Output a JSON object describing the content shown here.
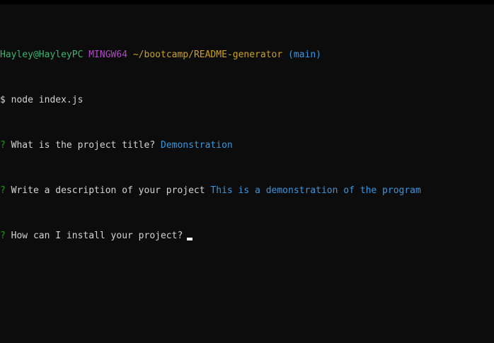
{
  "colors": {
    "user_host": "#3cb371",
    "system": "#b148c6",
    "path": "#c9a227",
    "branch": "#3a96dd",
    "text": "#d4d4d4",
    "answer": "#3a96dd",
    "question_mark": "#13a10e"
  },
  "prompt_line": {
    "user_host": "Hayley@HayleyPC",
    "system": "MINGW64",
    "path": "~/bootcamp/README-generator",
    "branch": "(main)"
  },
  "command_line": {
    "symbol": "$",
    "command": "node index.js"
  },
  "questions": [
    {
      "marker": "?",
      "question": "What is the project title?",
      "answer": "Demonstration"
    },
    {
      "marker": "?",
      "question": "Write a description of your project",
      "answer": "This is a demonstration of the program"
    },
    {
      "marker": "?",
      "question": "How can I install your project?",
      "answer": ""
    }
  ]
}
